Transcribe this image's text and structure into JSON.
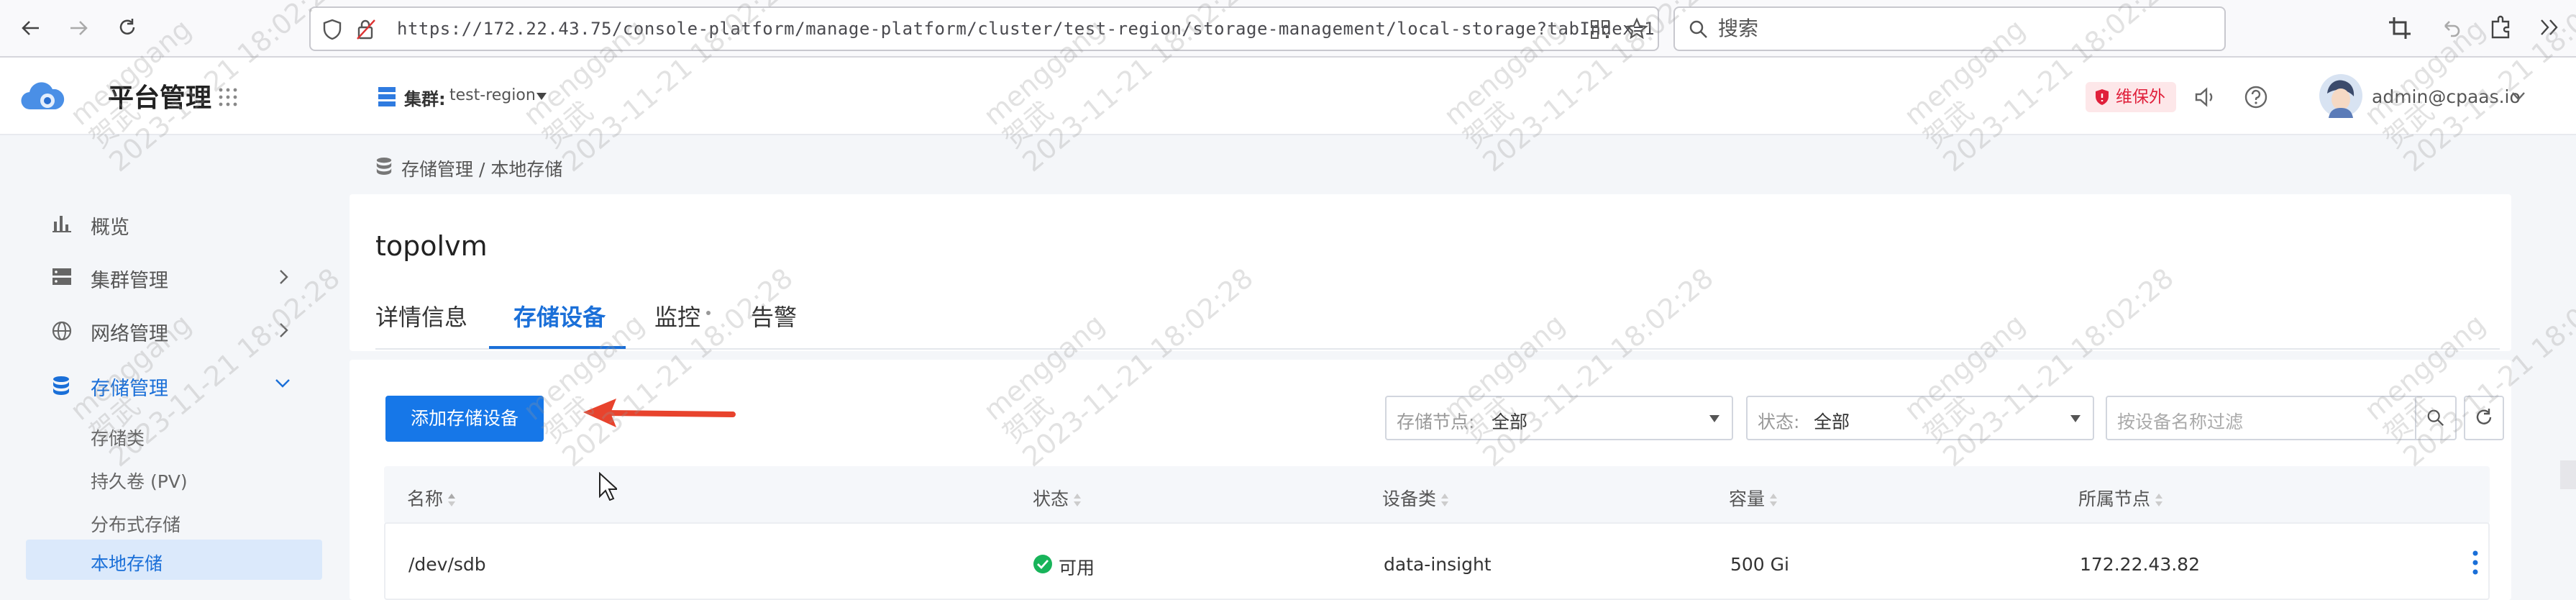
{
  "browser": {
    "url": "https://172.22.43.75/console-platform/manage-platform/cluster/test-region/storage-management/local-storage?tabIndex=1",
    "search_placeholder": "搜索"
  },
  "header": {
    "brand_title": "平台管理",
    "cluster_label": "集群:",
    "cluster_value": "test-region",
    "maintenance_badge": "维保外",
    "user": "admin@cpaas.io"
  },
  "sidebar": {
    "items": [
      {
        "label": "概览",
        "icon": "bar-chart-icon"
      },
      {
        "label": "集群管理",
        "icon": "server-icon"
      },
      {
        "label": "网络管理",
        "icon": "globe-icon"
      },
      {
        "label": "存储管理",
        "icon": "database-icon"
      }
    ],
    "sub_items": [
      {
        "label": "存储类"
      },
      {
        "label": "持久卷 (PV)"
      },
      {
        "label": "分布式存储"
      },
      {
        "label": "本地存储"
      }
    ]
  },
  "breadcrumb": "存储管理 / 本地存储",
  "page_title": "topolvm",
  "tabs": [
    {
      "label": "详情信息"
    },
    {
      "label": "存储设备"
    },
    {
      "label": "监控"
    },
    {
      "label": "告警"
    }
  ],
  "toolbar": {
    "add_button": "添加存储设备",
    "node_filter_label": "存储节点:",
    "node_filter_value": "全部",
    "status_filter_label": "状态:",
    "status_filter_value": "全部",
    "name_filter_placeholder": "按设备名称过滤"
  },
  "table": {
    "headers": [
      "名称",
      "状态",
      "设备类",
      "容量",
      "所属节点"
    ],
    "rows": [
      {
        "name": "/dev/sdb",
        "status": "可用",
        "device_class": "data-insight",
        "capacity": "500 Gi",
        "node": "172.22.43.82"
      }
    ]
  },
  "watermark": {
    "user": "menggang",
    "name": "贺武",
    "time": "2023-11-21 18:02:28"
  },
  "colors": {
    "primary": "#1677e8",
    "success": "#18b45a",
    "danger": "#e0203b",
    "arrow": "#e8432d"
  }
}
